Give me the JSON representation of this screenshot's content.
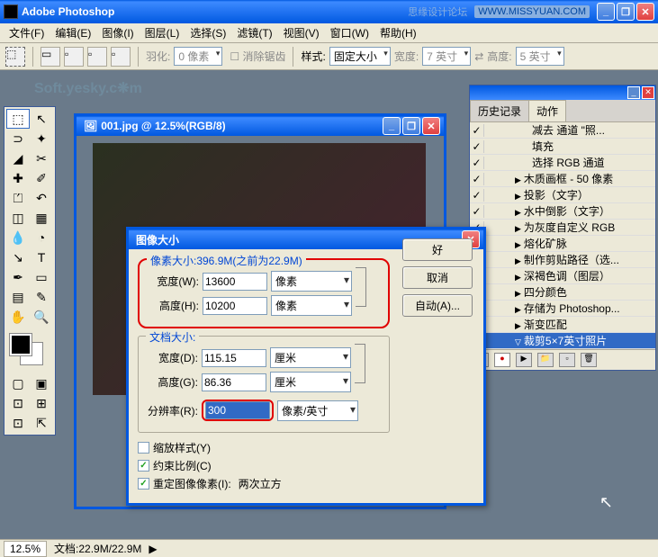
{
  "app": {
    "title": "Adobe Photoshop",
    "watermark": "思缘设计论坛",
    "url": "WWW.MISSYUAN.COM"
  },
  "menu": [
    "文件(F)",
    "编辑(E)",
    "图像(I)",
    "图层(L)",
    "选择(S)",
    "滤镜(T)",
    "视图(V)",
    "窗口(W)",
    "帮助(H)"
  ],
  "options": {
    "feather_label": "羽化:",
    "feather_val": "0 像素",
    "antialias": "消除锯齿",
    "style_label": "样式:",
    "style_val": "固定大小",
    "width_label": "宽度:",
    "width_val": "7 英寸",
    "height_label": "高度:",
    "height_val": "5 英寸"
  },
  "watermark2": "Soft.yesky.c❋m",
  "doc": {
    "title": "001.jpg @ 12.5%(RGB/8)"
  },
  "dialog": {
    "title": "图像大小",
    "pixels_legend": "像素大小:396.9M(之前为22.9M)",
    "w_label": "宽度(W):",
    "w_val": "13600",
    "w_unit": "像素",
    "h_label": "高度(H):",
    "h_val": "10200",
    "h_unit": "像素",
    "doc_legend": "文档大小:",
    "dw_label": "宽度(D):",
    "dw_val": "115.15",
    "dw_unit": "厘米",
    "dh_label": "高度(G):",
    "dh_val": "86.36",
    "dh_unit": "厘米",
    "res_label": "分辨率(R):",
    "res_val": "300",
    "res_unit": "像素/英寸",
    "scale_styles": "缩放样式(Y)",
    "constrain": "约束比例(C)",
    "resample": "重定图像像素(I):",
    "resample_val": "两次立方",
    "ok": "好",
    "cancel": "取消",
    "auto": "自动(A)..."
  },
  "panel": {
    "tabs": [
      "历史记录",
      "动作"
    ],
    "items": [
      {
        "chk": "✓",
        "arrow": "",
        "text": "减去 通道 \"照...",
        "indent": 34
      },
      {
        "chk": "✓",
        "arrow": "",
        "text": "填充",
        "indent": 34
      },
      {
        "chk": "✓",
        "arrow": "",
        "text": "选择 RGB 通道",
        "indent": 34
      },
      {
        "chk": "✓",
        "arrow": "▶",
        "text": "木质画框 - 50 像素",
        "indent": 18
      },
      {
        "chk": "✓",
        "arrow": "▶",
        "text": "投影（文字）",
        "indent": 18
      },
      {
        "chk": "✓",
        "arrow": "▶",
        "text": "水中倒影（文字）",
        "indent": 18
      },
      {
        "chk": "✓",
        "arrow": "▶",
        "text": "为灰度自定义 RGB",
        "indent": 18
      },
      {
        "chk": "✓",
        "arrow": "▶",
        "text": "熔化矿脉",
        "indent": 18
      },
      {
        "chk": "✓",
        "arrow": "▶",
        "text": "制作剪贴路径（选...",
        "indent": 18
      },
      {
        "chk": "✓",
        "arrow": "▶",
        "text": "深褐色调（图层）",
        "indent": 18
      },
      {
        "chk": "✓",
        "arrow": "▶",
        "text": "四分颜色",
        "indent": 18
      },
      {
        "chk": "✓",
        "arrow": "▶",
        "text": "存储为 Photoshop...",
        "indent": 18
      },
      {
        "chk": "✓",
        "arrow": "▶",
        "text": "渐变匹配",
        "indent": 18
      },
      {
        "chk": "✓",
        "arrow": "▽",
        "text": "裁剪5×7英寸照片",
        "indent": 18,
        "sel": true
      }
    ]
  },
  "status": {
    "zoom": "12.5%",
    "docsize": "文档:22.9M/22.9M"
  },
  "tools": [
    "▭",
    "↖",
    "⊡",
    "✥",
    "◢",
    "✂",
    "✎",
    "✐",
    "⌫",
    "▨",
    "⟋",
    "⧉",
    "◒",
    "◐",
    "●",
    "⬚",
    "↘",
    "T",
    "⬈",
    "▢",
    "✋",
    "🔍"
  ]
}
